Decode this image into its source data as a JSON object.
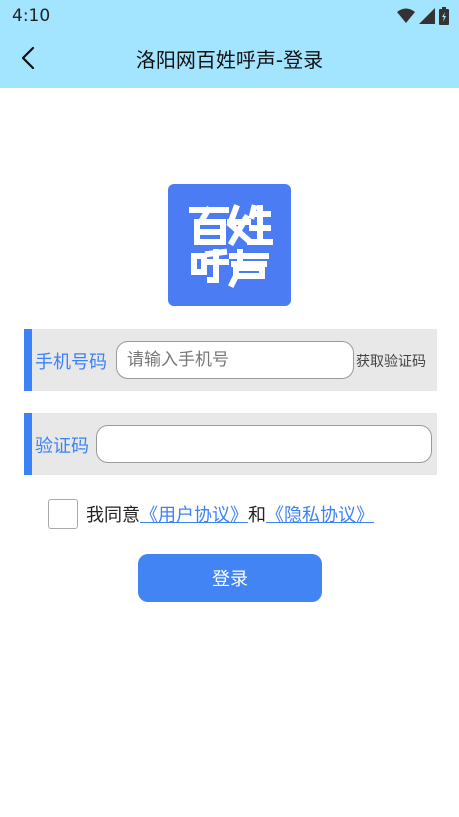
{
  "status_bar": {
    "time": "4:10",
    "icons": [
      "wifi-icon",
      "signal-icon",
      "battery-icon"
    ]
  },
  "nav": {
    "back_icon": "chevron-left-icon",
    "title": "洛阳网百姓呼声-登录"
  },
  "logo": {
    "text_line1": "百姓",
    "text_line2": "呼声",
    "background_color": "#4b7cf3"
  },
  "form": {
    "phone": {
      "label": "手机号码",
      "placeholder": "请输入手机号",
      "value": "",
      "get_code_label": "获取验证码"
    },
    "code": {
      "label": "验证码",
      "placeholder": "",
      "value": ""
    },
    "agreement": {
      "checked": false,
      "prefix": "我同意",
      "user_agreement": "《用户协议》",
      "conjunction": "和",
      "privacy_policy": "《隐私协议》"
    },
    "login_button": "登录"
  },
  "colors": {
    "header_bg": "#a3e4ff",
    "accent": "#3b82f6",
    "button_bg": "#4284f3",
    "row_bg": "#e8e8e8"
  }
}
